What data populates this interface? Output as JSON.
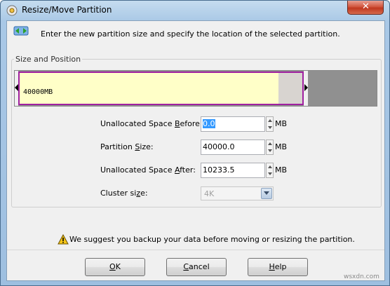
{
  "window": {
    "title": "Resize/Move Partition",
    "close_label": "✕"
  },
  "instruction": "Enter the new partition size and specify the location of the selected partition.",
  "group": {
    "label": "Size and Position"
  },
  "partition_bar": {
    "label": "40000MB",
    "unallocated_before_mb": 0.0,
    "partition_size_mb": 40000.0,
    "unallocated_after_mb": 10233.5,
    "colors": {
      "used": "#ffffc8",
      "free_in_partition": "#d8d4d0",
      "unallocated": "#909090",
      "border": "#a020a0"
    }
  },
  "fields": {
    "before": {
      "label_pre": "Unallocated Space ",
      "label_key": "B",
      "label_post": "efore:",
      "value": "0.0",
      "unit": "MB"
    },
    "size": {
      "label_pre": "Partition ",
      "label_key": "S",
      "label_post": "ize:",
      "value": "40000.0",
      "unit": "MB"
    },
    "after": {
      "label_pre": "Unallocated Space ",
      "label_key": "A",
      "label_post": "fter:",
      "value": "10233.5",
      "unit": "MB"
    },
    "cluster": {
      "label_pre": "Cluster si",
      "label_key": "z",
      "label_post": "e:",
      "value": "4K"
    }
  },
  "warning": "We suggest you backup your data before moving or resizing the partition.",
  "buttons": {
    "ok": {
      "key": "O",
      "rest": "K"
    },
    "cancel": {
      "key": "C",
      "rest": "ancel"
    },
    "help": {
      "key": "H",
      "rest": "elp"
    }
  },
  "watermark": "wsxdn.com"
}
